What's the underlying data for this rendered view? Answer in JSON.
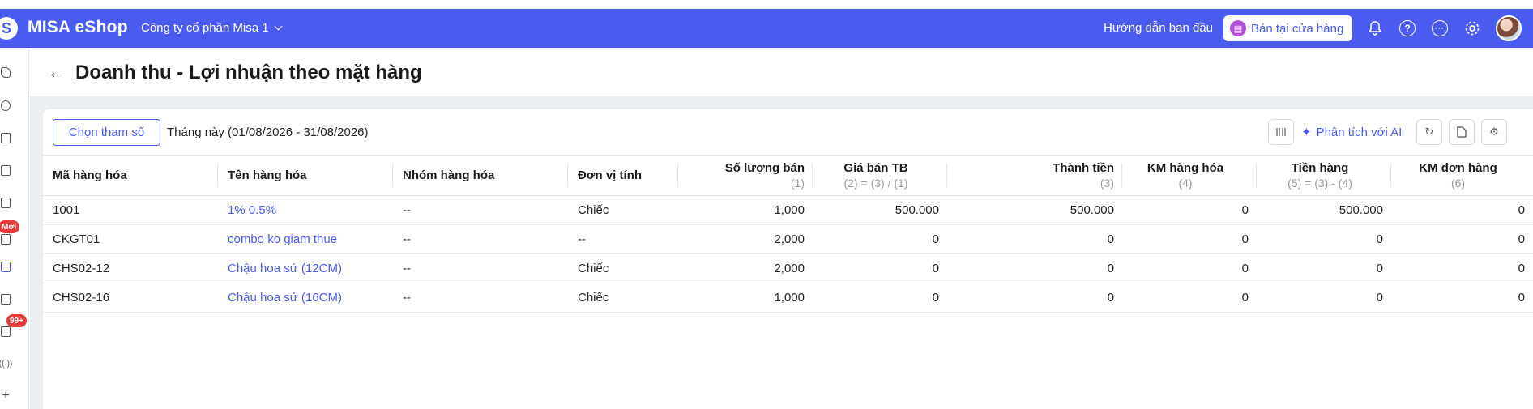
{
  "app": {
    "brand": "MISA eShop",
    "company": "Công ty cổ phần Misa 1"
  },
  "topbar": {
    "guide": "Hướng dẫn ban đầu",
    "store_button": "Bán tại cửa hàng"
  },
  "sidebar": {
    "badge_new": "Mới",
    "badge_count": "99+"
  },
  "page": {
    "title": "Doanh thu - Lợi nhuận theo mặt hàng"
  },
  "toolbar": {
    "param_button": "Chọn tham số",
    "period": "Tháng này (01/08/2026 - 31/08/2026)",
    "ai_button": "Phân tích với AI"
  },
  "table": {
    "columns": [
      {
        "label": "Mã hàng hóa",
        "sub": ""
      },
      {
        "label": "Tên hàng hóa",
        "sub": ""
      },
      {
        "label": "Nhóm hàng hóa",
        "sub": ""
      },
      {
        "label": "Đơn vị tính",
        "sub": ""
      },
      {
        "label": "Số lượng bán",
        "sub": "(1)"
      },
      {
        "label": "Giá bán TB",
        "sub": "(2) = (3) / (1)"
      },
      {
        "label": "Thành tiền",
        "sub": "(3)"
      },
      {
        "label": "KM hàng hóa",
        "sub": "(4)"
      },
      {
        "label": "Tiền hàng",
        "sub": "(5) = (3) - (4)"
      },
      {
        "label": "KM đơn hàng",
        "sub": "(6)"
      }
    ],
    "rows": [
      [
        "1001",
        "1% 0.5%",
        "--",
        "Chiếc",
        "1,000",
        "500.000",
        "500.000",
        "0",
        "500.000",
        "0"
      ],
      [
        "CKGT01",
        "combo ko giam thue",
        "--",
        "--",
        "2,000",
        "0",
        "0",
        "0",
        "0",
        "0"
      ],
      [
        "CHS02-12",
        "Chậu hoa sứ (12CM)",
        "--",
        "Chiếc",
        "2,000",
        "0",
        "0",
        "0",
        "0",
        "0"
      ],
      [
        "CHS02-16",
        "Chậu hoa sứ (16CM)",
        "--",
        "Chiếc",
        "1,000",
        "0",
        "0",
        "0",
        "0",
        "0"
      ]
    ]
  }
}
